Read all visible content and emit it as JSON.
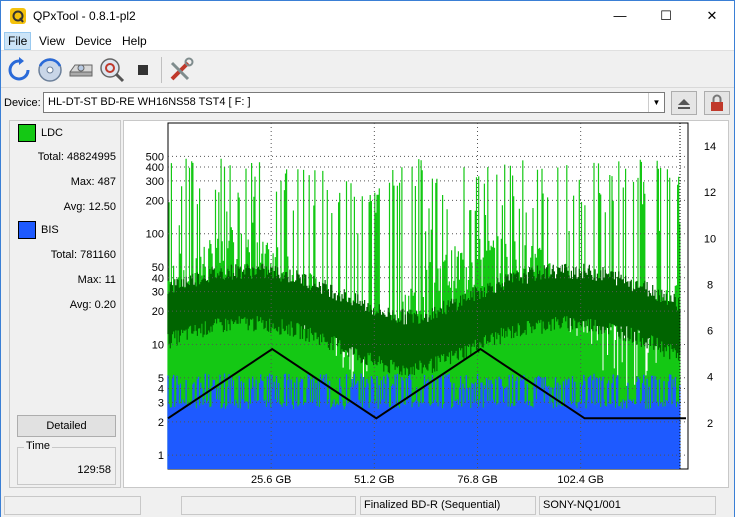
{
  "window": {
    "title": "QPxTool - 0.8.1-pl2",
    "minimize": "—",
    "maximize": "☐",
    "close": "✕"
  },
  "menu": {
    "items": [
      "File",
      "View",
      "Device",
      "Help"
    ]
  },
  "toolbar": {
    "buttons": [
      "refresh-icon",
      "disc-scan-icon",
      "drive-icon",
      "magnifier-disc-icon",
      "stop-icon",
      "settings-tools-icon"
    ]
  },
  "device": {
    "label": "Device:",
    "selected": "HL-DT-ST BD-RE  WH16NS58  TST4 [ F: ]"
  },
  "legend": {
    "ldc": {
      "name": "LDC",
      "color": "#14c814",
      "total_label": "Total:",
      "total": "48824995",
      "max_label": "Max:",
      "max": "487",
      "avg_label": "Avg:",
      "avg": "12.50"
    },
    "bis": {
      "name": "BIS",
      "color": "#1e5aff",
      "total_label": "Total:",
      "total": "781160",
      "max_label": "Max:",
      "max": "11",
      "avg_label": "Avg:",
      "avg": "0.20"
    }
  },
  "buttons": {
    "detailed": "Detailed"
  },
  "time": {
    "label": "Time",
    "value": "129:58"
  },
  "status": {
    "cell1": "",
    "cell2": "",
    "cell3": "Finalized BD-R (Sequential)",
    "cell4": "SONY-NQ1/001"
  },
  "colors": {
    "ldc_light": "#14c814",
    "ldc_dark": "#006400",
    "bis": "#1e5aff",
    "speed": "#000000"
  },
  "chart_data": {
    "type": "area",
    "series": [
      {
        "name": "LDC",
        "color": "#14c814"
      },
      {
        "name": "BIS",
        "color": "#1e5aff"
      }
    ],
    "x_ticks": [
      "25.6 GB",
      "51.2 GB",
      "76.8 GB",
      "102.4 GB"
    ],
    "x_tick_values": [
      25.6,
      51.2,
      76.8,
      102.4
    ],
    "xlim": [
      0,
      128
    ],
    "y_left_ticks": [
      "500",
      "400",
      "300",
      "200",
      "100",
      "50",
      "40",
      "30",
      "20",
      "10",
      "5",
      "4",
      "3",
      "2",
      "1"
    ],
    "y_left_values": [
      500,
      400,
      300,
      200,
      100,
      50,
      40,
      30,
      20,
      10,
      5,
      4,
      3,
      2,
      1
    ],
    "y_left_scale": "log",
    "ylim_left": [
      0.75,
      1000
    ],
    "y_right_ticks": [
      "14",
      "12",
      "10",
      "8",
      "6",
      "4",
      "2"
    ],
    "y_right_values": [
      14,
      12,
      10,
      8,
      6,
      4,
      2
    ],
    "ylim_right": [
      0,
      15
    ],
    "speed_curve": {
      "x": [
        0,
        25.6,
        51.2,
        76.8,
        102.4,
        128
      ],
      "y": [
        2.2,
        5.2,
        2.2,
        5.2,
        2.2,
        2.2
      ]
    },
    "grid": true
  }
}
